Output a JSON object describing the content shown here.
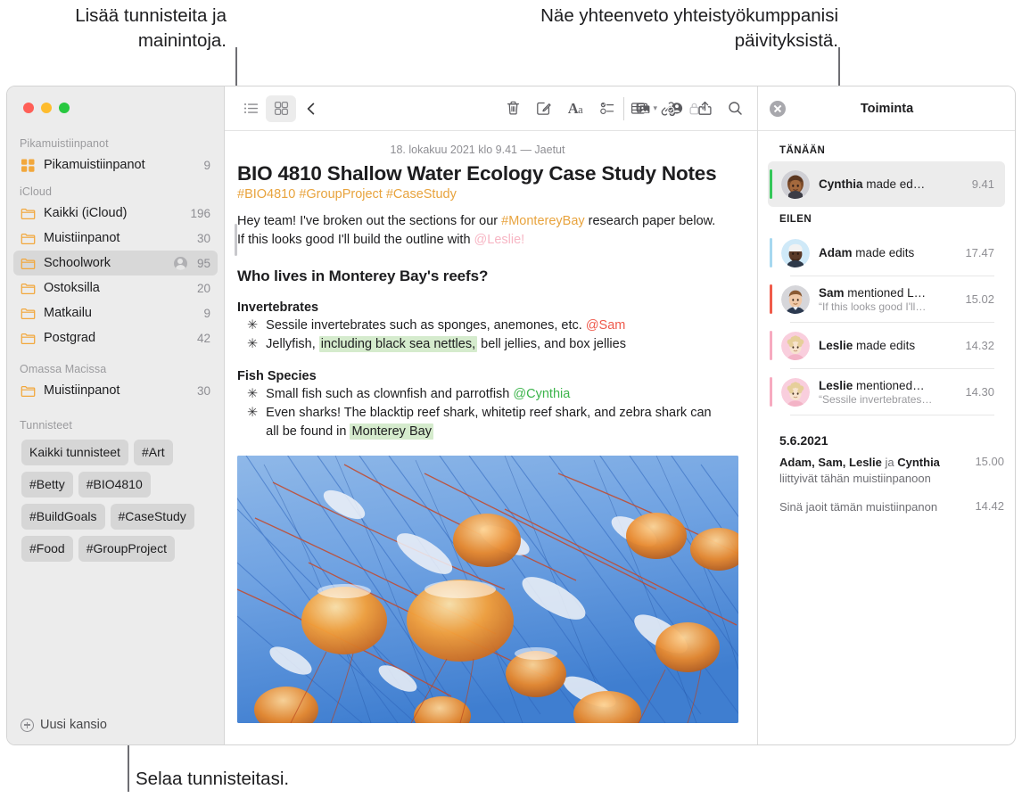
{
  "callouts": {
    "tags": "Lisää tunnisteita ja\nmainintoja.",
    "activity": "Näe yhteenveto yhteistyökumppanisi\npäivityksistä.",
    "browse": "Selaa tunnisteitasi."
  },
  "sidebar": {
    "sections": [
      {
        "title": "Pikamuistiinpanot",
        "rows": [
          {
            "icon": "quick-notes-icon",
            "label": "Pikamuistiinpanot",
            "count": "9",
            "selected": false,
            "shared": false
          }
        ]
      },
      {
        "title": "iCloud",
        "rows": [
          {
            "icon": "folder-icon",
            "label": "Kaikki (iCloud)",
            "count": "196",
            "selected": false,
            "shared": false
          },
          {
            "icon": "folder-icon",
            "label": "Muistiinpanot",
            "count": "30",
            "selected": false,
            "shared": false
          },
          {
            "icon": "folder-icon",
            "label": "Schoolwork",
            "count": "95",
            "selected": true,
            "shared": true
          },
          {
            "icon": "folder-icon",
            "label": "Ostoksilla",
            "count": "20",
            "selected": false,
            "shared": false
          },
          {
            "icon": "folder-icon",
            "label": "Matkailu",
            "count": "9",
            "selected": false,
            "shared": false
          },
          {
            "icon": "folder-icon",
            "label": "Postgrad",
            "count": "42",
            "selected": false,
            "shared": false
          }
        ]
      },
      {
        "title": "Omassa Macissa",
        "rows": [
          {
            "icon": "folder-icon",
            "label": "Muistiinpanot",
            "count": "30",
            "selected": false,
            "shared": false
          }
        ]
      }
    ],
    "tags_section_title": "Tunnisteet",
    "tags": [
      "Kaikki tunnisteet",
      "#Art",
      "#Betty",
      "#BIO4810",
      "#BuildGoals",
      "#CaseStudy",
      "#Food",
      "#GroupProject"
    ],
    "new_folder_label": "Uusi kansio",
    "folder_color": "#f2a73b",
    "selected_row_bg": "#d8d8d8"
  },
  "toolbar": {
    "left": [
      {
        "name": "list-view-icon",
        "label": "Luettelonäkymä",
        "active": false
      },
      {
        "name": "gallery-view-icon",
        "label": "Galleriänäkymä",
        "active": true
      },
      {
        "name": "back-chevron-icon",
        "label": "Takaisin",
        "active": false
      }
    ],
    "center": [
      {
        "name": "trash-icon",
        "label": "Poista"
      },
      {
        "name": "compose-icon",
        "label": "Uusi muistiinpano"
      },
      {
        "name": "format-icon",
        "label": "Muotoilu"
      },
      {
        "name": "checklist-icon",
        "label": "Tarkistuslista"
      },
      {
        "name": "table-icon",
        "label": "Taulukko"
      },
      {
        "name": "link-add-icon",
        "label": "Lisää linkki"
      },
      {
        "name": "lock-icon",
        "label": "Lukitse muistiinpano"
      }
    ],
    "right": [
      {
        "name": "media-icon",
        "label": "Media"
      },
      {
        "name": "add-people-icon",
        "label": "Lisää ihmisiä"
      },
      {
        "name": "share-icon",
        "label": "Jaa"
      },
      {
        "name": "search-icon",
        "label": "Etsi"
      }
    ]
  },
  "note": {
    "date": "18. lokakuu 2021 klo 9.41 — Jaetut",
    "title": "BIO 4810 Shallow Water Ecology Case Study Notes",
    "tags_line": "#BIO4810 #GroupProject #CaseStudy",
    "intro": {
      "part1": "Hey team! I've broken out the sections for our ",
      "tag": "#MontereyBay",
      "part2": " research paper below. If this looks good I'll build the outline with ",
      "mention": "@Leslie!"
    },
    "heading": "Who lives in Monterey Bay's reefs?",
    "groups": [
      {
        "subheading": "Invertebrates",
        "bullets": [
          {
            "pre": "Sessile invertebrates such as sponges, anemones, etc. ",
            "mention": "@Sam",
            "mention_color": "red",
            "post": ""
          },
          {
            "pre": "Jellyfish, ",
            "highlight": "including black sea nettles,",
            "post": " bell jellies, and box jellies"
          }
        ]
      },
      {
        "subheading": "Fish Species",
        "bullets": [
          {
            "pre": "Small fish such as clownfish and parrotfish ",
            "mention": "@Cynthia",
            "mention_color": "green",
            "post": ""
          },
          {
            "pre": "Even sharks! The blacktip reef shark, whitetip reef shark, and zebra shark can all be found in ",
            "highlight": "Monterey Bay",
            "post": ""
          }
        ]
      }
    ],
    "photo_alt": "jellyfish-photo"
  },
  "activity": {
    "title": "Toiminta",
    "close_label": "Sulje",
    "groups": [
      {
        "label": "TÄNÄÄN",
        "items": [
          {
            "avatar": "cynthia-avatar",
            "accent": "#34c759",
            "name": "Cynthia",
            "action": " made ed…",
            "quote": "",
            "time": "9.41",
            "highlighted": true
          }
        ]
      },
      {
        "label": "EILEN",
        "items": [
          {
            "avatar": "adam-avatar",
            "accent": "#a6d8f0",
            "name": "Adam",
            "action": " made edits",
            "quote": "",
            "time": "17.47",
            "highlighted": false
          },
          {
            "avatar": "sam-avatar",
            "accent": "#f05b4a",
            "name": "Sam",
            "action": " mentioned L…",
            "quote": "“If this looks good I'll…",
            "time": "15.02",
            "highlighted": false
          },
          {
            "avatar": "leslie-avatar",
            "accent": "#f7aac0",
            "name": "Leslie",
            "action": " made edits",
            "quote": "",
            "time": "14.32",
            "highlighted": false
          },
          {
            "avatar": "leslie-avatar",
            "accent": "#f7aac0",
            "name": "Leslie",
            "action": " mentioned…",
            "quote": "“Sessile invertebrates…",
            "time": "14.30",
            "highlighted": false
          }
        ]
      }
    ],
    "date_label": "5.6.2021",
    "plain_entries": [
      {
        "bold1": "Adam, Sam, Leslie",
        "mid": " ja ",
        "bold2": "Cynthia",
        "rest": " liittyivät tähän muistiinpanoon",
        "time": "15.00"
      },
      {
        "bold1": "",
        "mid": "",
        "bold2": "",
        "rest": "Sinä jaoit tämän muistiinpanon",
        "time": "14.42"
      }
    ]
  }
}
